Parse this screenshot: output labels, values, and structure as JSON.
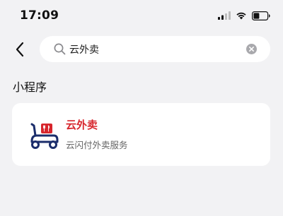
{
  "status_bar": {
    "time": "17:09"
  },
  "search": {
    "value": "云外卖",
    "placeholder": "",
    "icons": {
      "back": "chevron-left-icon",
      "search": "search-icon",
      "clear": "clear-icon"
    }
  },
  "section": {
    "title": "小程序"
  },
  "result": {
    "name": "云外卖",
    "description": "云闪付外卖服务",
    "name_color": "#d7252c",
    "logo_colors": {
      "scooter": "#1b2d6b",
      "bag": "#d7252c"
    }
  },
  "colors": {
    "background": "#f2f2f4",
    "card": "#ffffff"
  }
}
